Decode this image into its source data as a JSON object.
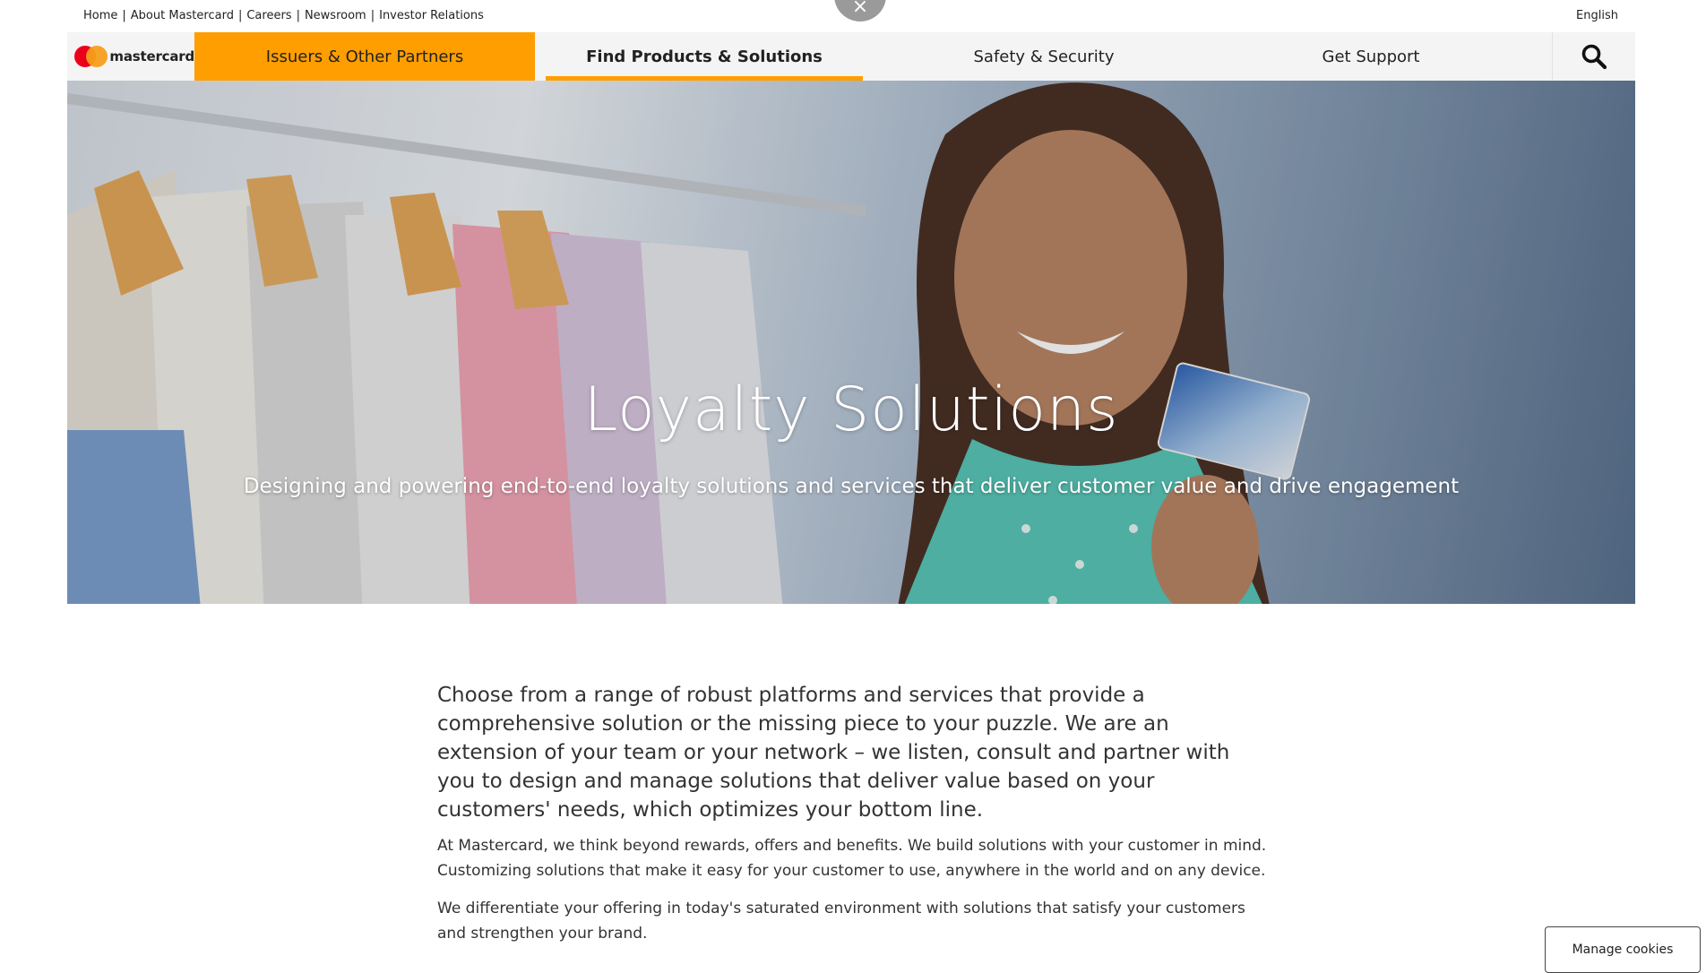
{
  "utility_links": [
    "Home",
    "About Mastercard",
    "Careers",
    "Newsroom",
    "Investor Relations"
  ],
  "utility_separator": "|",
  "language": "English",
  "brand": {
    "name": "mastercard",
    "colors": {
      "red": "#eb001b",
      "orange": "#f79e1b"
    }
  },
  "nav": {
    "issuers": "Issuers & Other Partners",
    "find": "Find Products & Solutions",
    "safety": "Safety & Security",
    "support": "Get Support",
    "search_icon": "search-icon"
  },
  "accent_color": "#ff9e00",
  "hero": {
    "title": "Loyalty Solutions",
    "subtitle": "Designing and powering end-to-end loyalty solutions and services that deliver customer value and drive engagement"
  },
  "content": {
    "lead": "Choose from a range of robust platforms and services that provide a comprehensive solution or the missing piece to your puzzle. We are an extension of your team or your network – we listen, consult and partner with you to design and manage solutions that deliver value based on your customers' needs, which optimizes your bottom line.",
    "para1": "At Mastercard, we think beyond rewards, offers and benefits. We build solutions with your customer in mind. Customizing solutions that make it easy for your customer to use, anywhere in the world and on any device.",
    "para2": "We differentiate your offering in today's saturated environment with solutions that satisfy your customers and strengthen your brand."
  },
  "cookies_button": "Manage cookies",
  "close_glyph": "×"
}
